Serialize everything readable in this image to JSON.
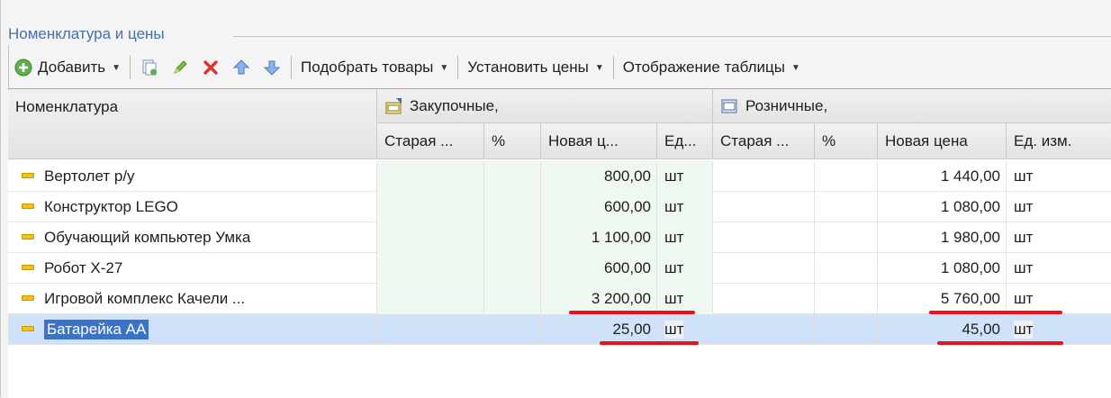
{
  "group": {
    "title": "Номенклатура и цены"
  },
  "toolbar": {
    "add_label": "Добавить",
    "pick_label": "Подобрать товары",
    "set_prices_label": "Установить цены",
    "table_view_label": "Отображение таблицы",
    "icons": [
      "add-circle-icon",
      "copy-document-icon",
      "edit-pencil-icon",
      "delete-x-icon",
      "move-up-icon",
      "move-down-icon"
    ]
  },
  "table": {
    "headers": {
      "name": "Номенклатура",
      "purchase_group": "Закупочные,",
      "retail_group": "Розничные,",
      "old": "Старая ...",
      "percent": "%",
      "new_short": "Новая ц...",
      "unit_short": "Ед...",
      "new_full": "Новая цена",
      "unit_full": "Ед. изм."
    },
    "rows": [
      {
        "name": "Вертолет р/у",
        "purchase_new": "800,00",
        "purchase_unit": "шт",
        "retail_new": "1 440,00",
        "retail_unit": "шт"
      },
      {
        "name": "Конструктор LEGO",
        "purchase_new": "600,00",
        "purchase_unit": "шт",
        "retail_new": "1 080,00",
        "retail_unit": "шт"
      },
      {
        "name": "Обучающий компьютер Умка",
        "purchase_new": "1 100,00",
        "purchase_unit": "шт",
        "retail_new": "1 980,00",
        "retail_unit": "шт"
      },
      {
        "name": "Робот Х-27",
        "purchase_new": "600,00",
        "purchase_unit": "шт",
        "retail_new": "1 080,00",
        "retail_unit": "шт"
      },
      {
        "name": "Игровой комплекс Качели ...",
        "purchase_new": "3 200,00",
        "purchase_unit": "шт",
        "retail_new": "5 760,00",
        "retail_unit": "шт"
      },
      {
        "name": "Батарейка АА",
        "purchase_new": "25,00",
        "purchase_unit": "шт",
        "retail_new": "45,00",
        "retail_unit": "шт"
      }
    ]
  },
  "colors": {
    "accent_underline": "#e8121b",
    "selection": "#3a73c7",
    "row_highlight": "#cfe2f9"
  }
}
